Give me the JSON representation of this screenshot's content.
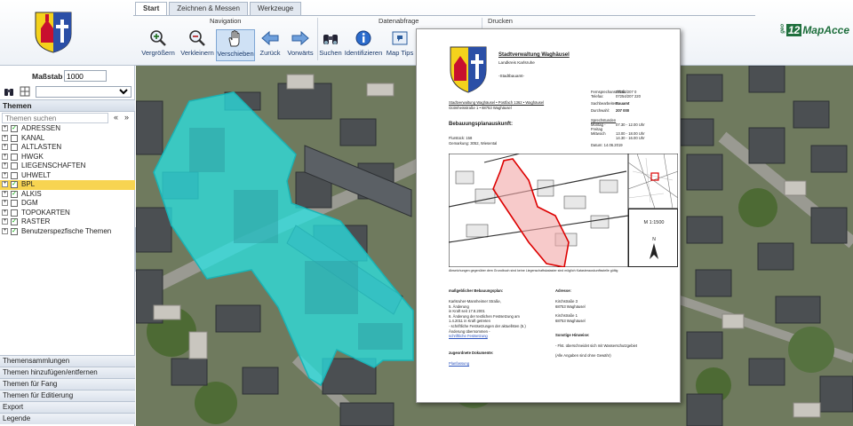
{
  "header": {
    "tabs": [
      "Start",
      "Zeichnen & Messen",
      "Werkzeuge"
    ],
    "groups": {
      "navigation": "Navigation",
      "datenabfrage": "Datenabfrage",
      "drucken": "Drucken"
    },
    "tools": [
      {
        "label": "Vergrößern",
        "icon": "zoom-in-icon"
      },
      {
        "label": "Verkleinern",
        "icon": "zoom-out-icon"
      },
      {
        "label": "Verschieben",
        "icon": "hand-icon"
      },
      {
        "label": "Zurück",
        "icon": "arrow-left-icon"
      },
      {
        "label": "Vorwärts",
        "icon": "arrow-right-icon"
      },
      {
        "label": "Suchen",
        "icon": "binoculars-icon"
      },
      {
        "label": "Identifizieren",
        "icon": "info-icon"
      },
      {
        "label": "Map Tips",
        "icon": "map-tips-icon"
      }
    ],
    "brand": {
      "geo": "geo",
      "two": "12",
      "name": "MapAcce"
    }
  },
  "left": {
    "scale_label": "Maßstab 1:",
    "scale_value": "1000",
    "themes_title": "Themen",
    "search_placeholder": "Themen suchen",
    "themes": [
      {
        "label": "ADRESSEN",
        "checked": true
      },
      {
        "label": "KANAL",
        "checked": false
      },
      {
        "label": "ALTLASTEN",
        "checked": false
      },
      {
        "label": "HWGK",
        "checked": false
      },
      {
        "label": "LIEGENSCHAFTEN",
        "checked": false
      },
      {
        "label": "UHWELT",
        "checked": false
      },
      {
        "label": "BPL",
        "checked": true
      },
      {
        "label": "ALKIS",
        "checked": true
      },
      {
        "label": "DGM",
        "checked": false
      },
      {
        "label": "TOPOKARTEN",
        "checked": false
      },
      {
        "label": "RASTER",
        "checked": true
      },
      {
        "label": "Benutzerspezfische Themen",
        "checked": true
      }
    ],
    "accordion": [
      "Themensammlungen",
      "Themen hinzufügen/entfernen",
      "Themen für Fang",
      "Themen für Editierung",
      "Export",
      "Legende"
    ]
  },
  "doc": {
    "org": "Stadtverwaltung Waghäusel",
    "district": "Landkreis Karlsruhe",
    "dept": "-Stadtbauamt-",
    "sender": "Stadtverwaltung Waghäusel • Postfach 1362 • Waghäusel",
    "recipient": "Gütmheisstraße 1 • 68753 Waghäusel",
    "contact": [
      [
        "Fernsprechanschluß:",
        "07254/207 0"
      ],
      [
        "Telefax:",
        "07254/207 220"
      ],
      [
        "Sachbearbeiter:",
        "Bauamt"
      ],
      [
        "Durchwahl:",
        "207 000"
      ]
    ],
    "hours_title": "Sprechstunden",
    "hours": [
      [
        "Montag - Freitag",
        "07.30 - 12.00 Uhr"
      ],
      [
        "Mittwoch",
        "13.00 - 18.00 Uhr"
      ],
      [
        "",
        "14.30 - 16.00 Uhr"
      ]
    ],
    "date": "Datum: 14.06.2019",
    "heading": "Bebauungsplanauskunft:",
    "flurstueck": "Flurstück: 158",
    "gemarkung": "Gemarkung: 3052, Wiesental",
    "scale": "M 1:1500",
    "north": "N",
    "caption": "Abweichungen gegenüber dem Grundbuch sind keine Liegenschaftskataster sind möglich Katasterauskunftsstelle gültig",
    "plan_title": "maßgeblicher Bebauungsplan:",
    "plan_lines": [
      "Karlsruher-Mannheimer Straße,",
      "5. Änderung",
      "in Kraft seit 17.8.2001",
      "6. Änderung der textlichen Festsetzung am",
      "1.4.2011 in Kraft getreten",
      "- schriftliche Festsetzungen der aktuellsten (5.)",
      "Änderung übernommen -"
    ],
    "plan_link": "schriftliche Festsetzung",
    "docs_title": "zugeordnete Dokumente:",
    "docs_link": "Planfassung",
    "address_title": "Adresse:",
    "addresses": [
      "Kirchstraße 3",
      "68753 Waghäusel",
      "",
      "Kirchstraße 1",
      "68753 Waghäusel"
    ],
    "notes_title": "Sonstige Hinweise:",
    "notes": [
      "- Flst. überschneidet sich mit Wasserschutzgebiet",
      "",
      "(Alle Angaben sind ohne Gewähr)"
    ]
  }
}
